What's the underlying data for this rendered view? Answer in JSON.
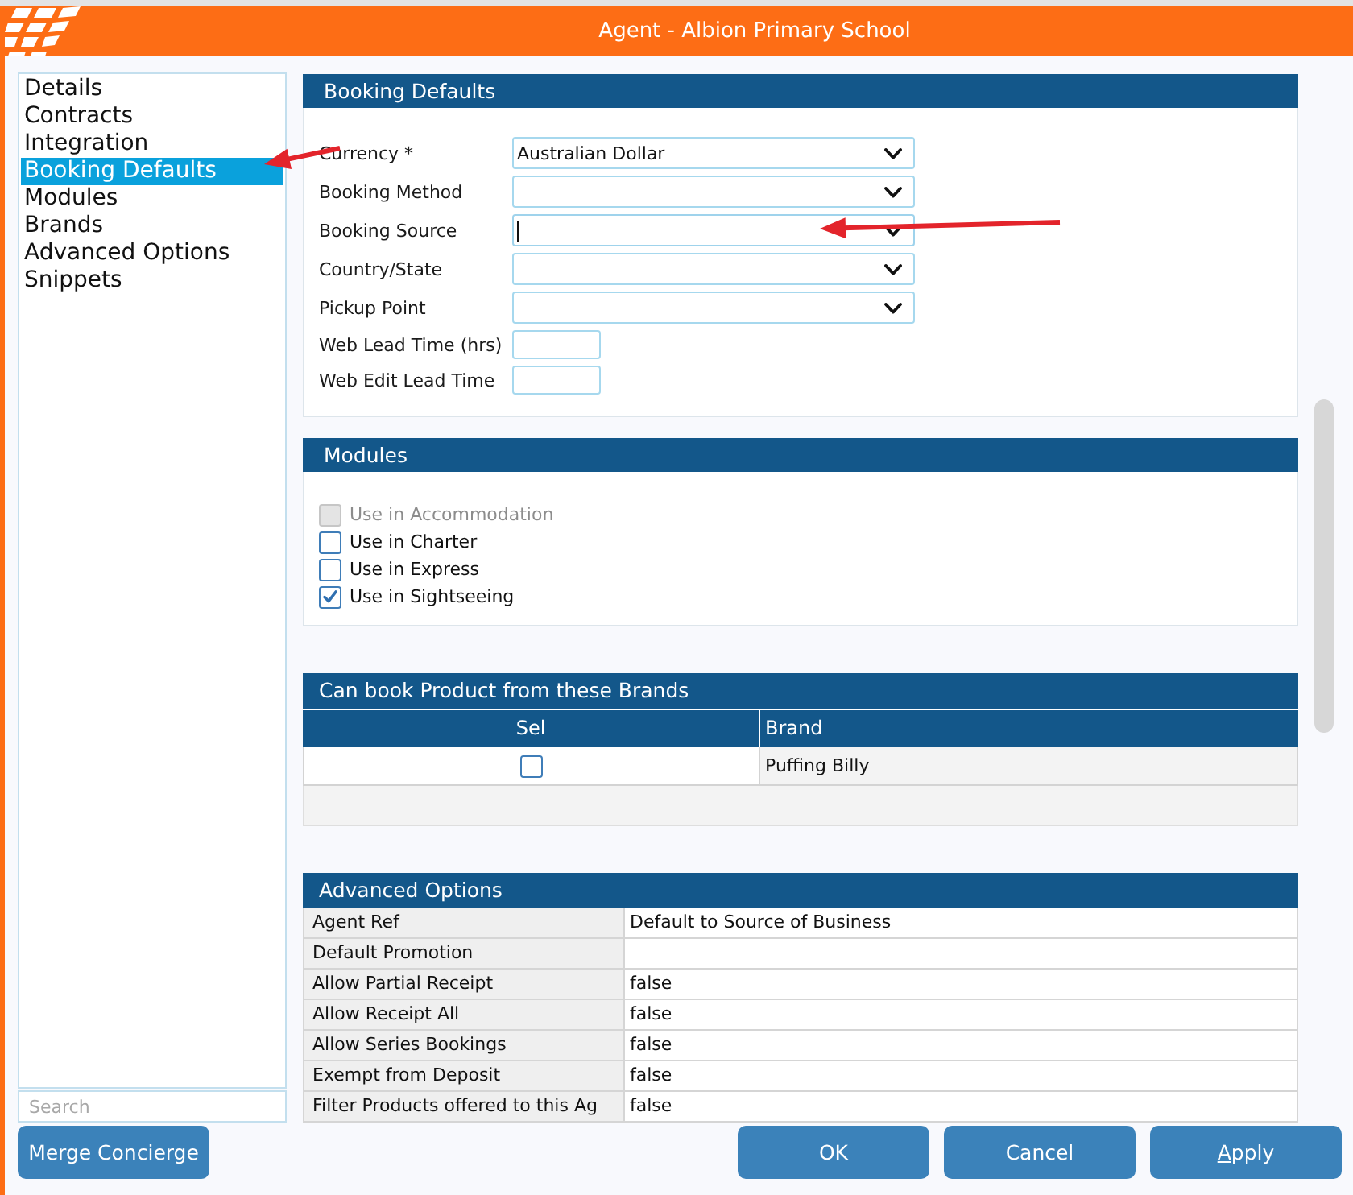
{
  "window": {
    "title": "Agent - Albion Primary School"
  },
  "sidebar": {
    "items": [
      {
        "label": "Details",
        "selected": false
      },
      {
        "label": "Contracts",
        "selected": false
      },
      {
        "label": "Integration",
        "selected": false
      },
      {
        "label": "Booking Defaults",
        "selected": true
      },
      {
        "label": "Modules",
        "selected": false
      },
      {
        "label": "Brands",
        "selected": false
      },
      {
        "label": "Advanced Options",
        "selected": false
      },
      {
        "label": "Snippets",
        "selected": false
      }
    ],
    "search": {
      "placeholder": "Search"
    }
  },
  "booking_defaults": {
    "title": "Booking Defaults",
    "fields": [
      {
        "label": "Currency *",
        "kind": "select",
        "value": "Australian Dollar",
        "focused": false
      },
      {
        "label": "Booking Method",
        "kind": "select",
        "focused": false
      },
      {
        "label": "Booking Source",
        "kind": "select",
        "focused": true
      },
      {
        "label": "Country/State",
        "kind": "select",
        "focused": false
      },
      {
        "label": "Pickup Point",
        "kind": "select",
        "focused": false
      },
      {
        "label": "Web Lead Time (hrs)",
        "kind": "text",
        "focused": false
      },
      {
        "label": "Web Edit Lead Time",
        "kind": "text",
        "focused": false
      }
    ]
  },
  "modules": {
    "title": "Modules",
    "items": [
      {
        "label": "Use in Accommodation",
        "checked": false,
        "disabled": true
      },
      {
        "label": "Use in Charter",
        "checked": false,
        "disabled": false
      },
      {
        "label": "Use in Express",
        "checked": false,
        "disabled": false
      },
      {
        "label": "Use in Sightseeing",
        "checked": true,
        "disabled": false
      }
    ]
  },
  "brands": {
    "title": "Can book Product from these Brands",
    "columns": [
      "Sel",
      "Brand"
    ],
    "rows": [
      {
        "checked": false,
        "brand": "Puffing Billy"
      }
    ]
  },
  "advanced_options": {
    "title": "Advanced Options",
    "rows": [
      {
        "label": "Agent Ref",
        "value": "Default to Source of Business"
      },
      {
        "label": "Default Promotion"
      },
      {
        "label": "Allow Partial Receipt",
        "value": "false"
      },
      {
        "label": "Allow Receipt All",
        "value": "false"
      },
      {
        "label": "Allow Series Bookings",
        "value": "false"
      },
      {
        "label": "Exempt from Deposit",
        "value": "false"
      },
      {
        "label": "Filter Products offered to this Ag",
        "value": "false"
      }
    ]
  },
  "buttons": {
    "left": [
      {
        "label": "Merge Concierge",
        "underlined_first_letter": false
      }
    ],
    "right": [
      {
        "label": "OK",
        "underlined_first_letter": false
      },
      {
        "label": "Cancel",
        "underlined_first_letter": false
      },
      {
        "label": "Apply",
        "underlined_first_letter": true
      }
    ]
  },
  "annotations": [
    {
      "kind": "arrow"
    },
    {
      "kind": "arrow"
    }
  ]
}
